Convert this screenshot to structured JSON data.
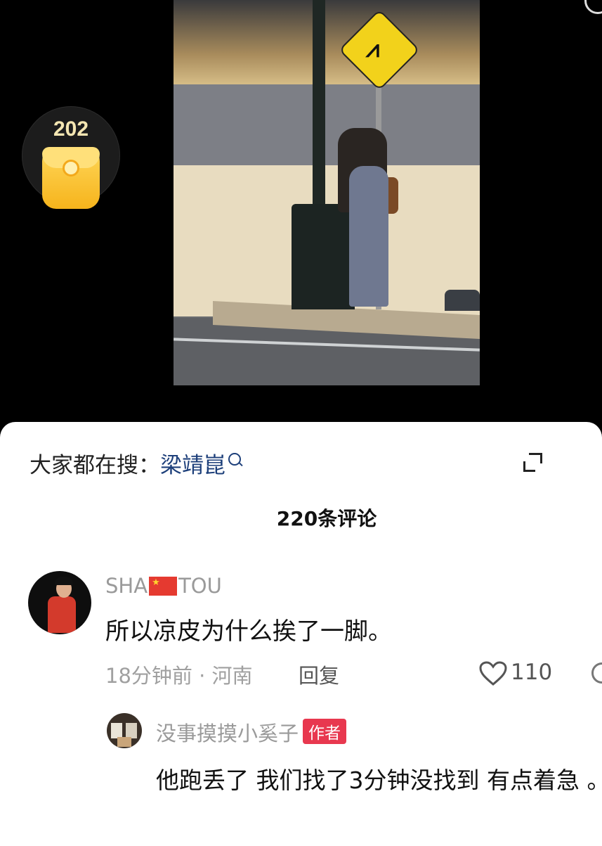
{
  "reward": {
    "count": "202"
  },
  "search": {
    "prefix": "大家都在搜：",
    "term": "梁靖崑"
  },
  "comments_header": "220条评论",
  "comments": [
    {
      "user_before_flag": "SHA",
      "user_after_flag": "TOU",
      "text": "所以凉皮为什么挨了一脚。",
      "time_location": "18分钟前 · 河南",
      "reply_label": "回复",
      "likes": "110"
    },
    {
      "user": "没事摸摸小奚子",
      "badge": "作者",
      "text": "他跑丢了 我们找了3分钟没找到 有点着急 。"
    }
  ]
}
